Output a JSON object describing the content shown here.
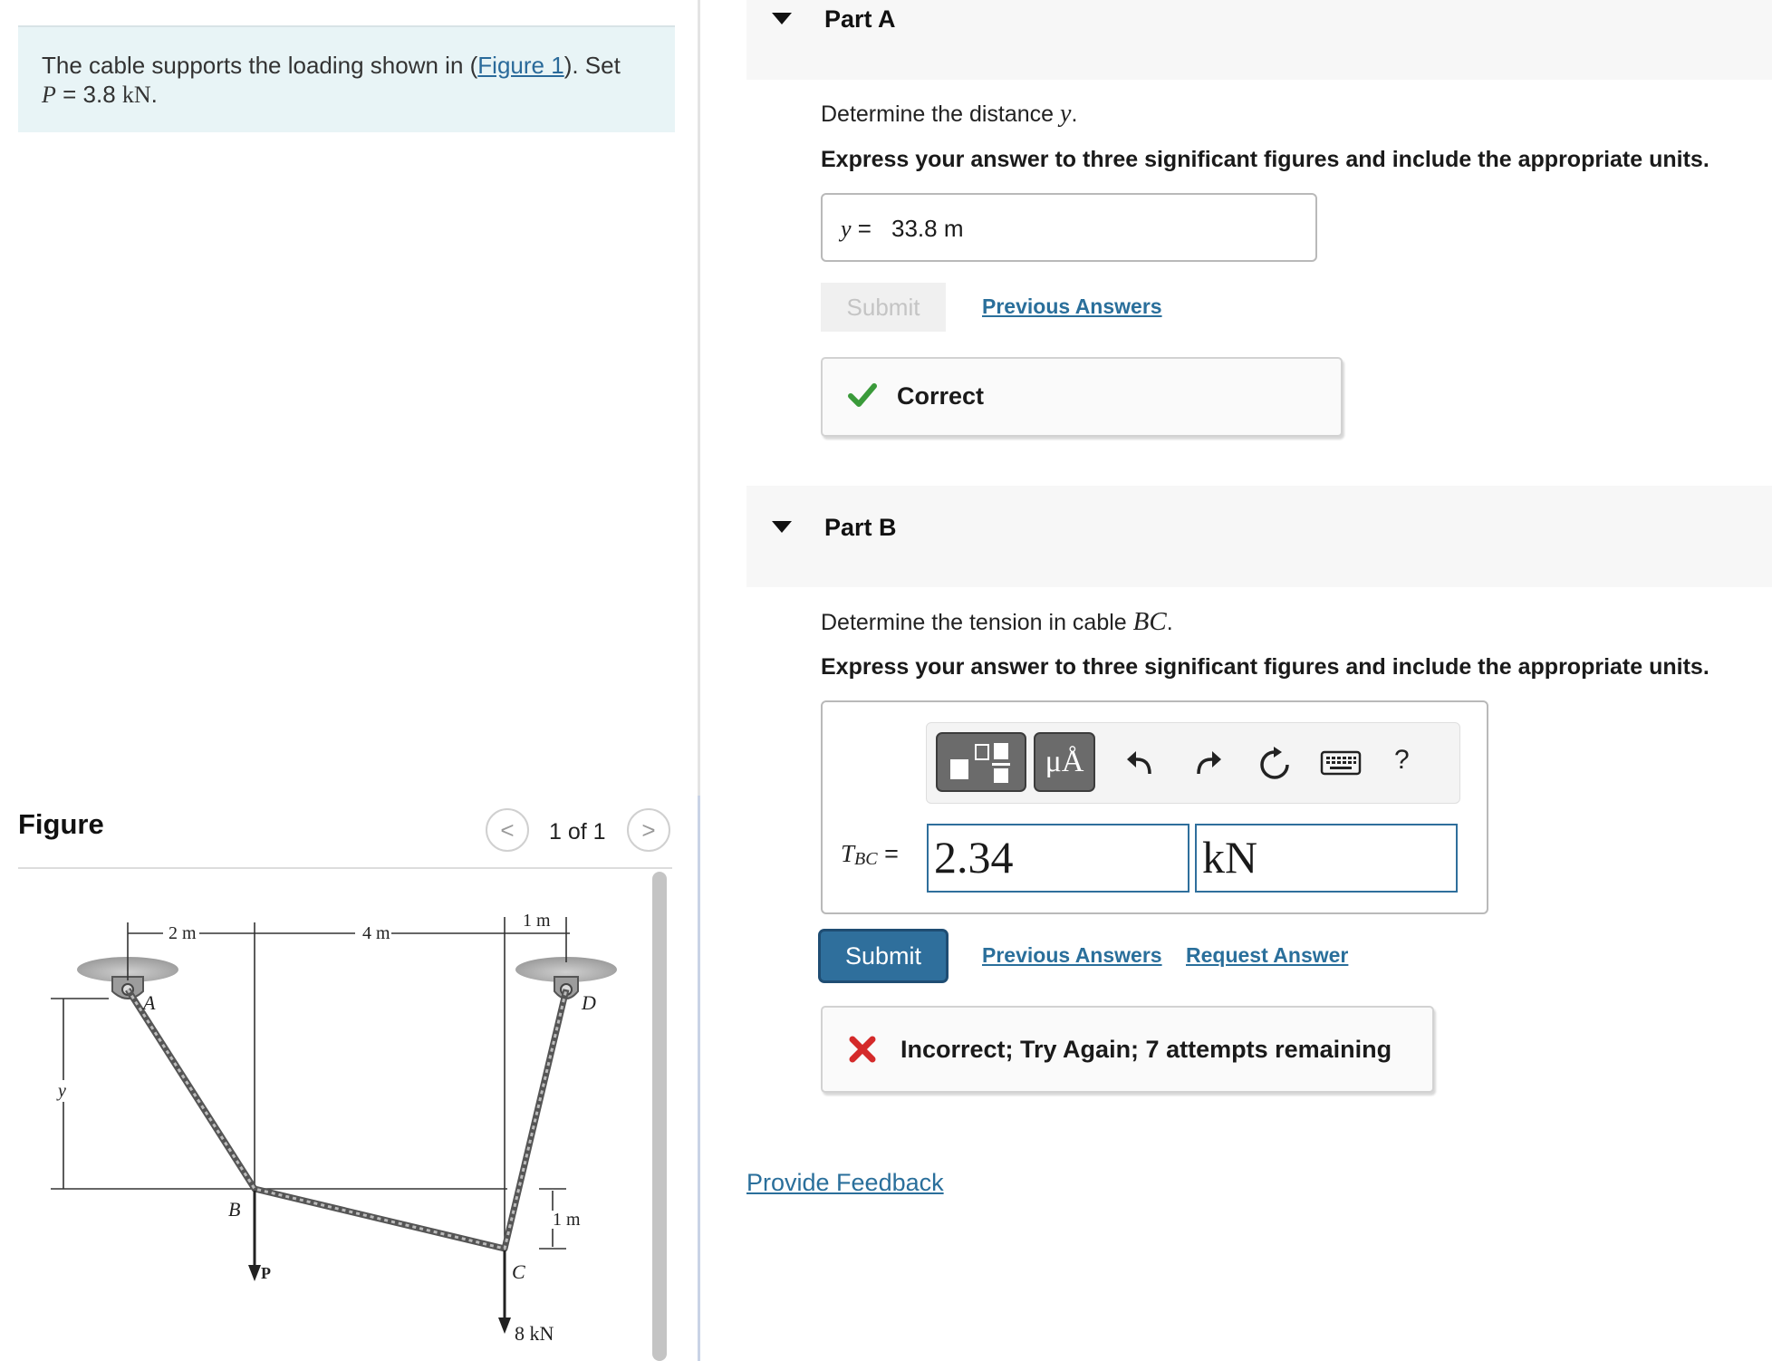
{
  "problem": {
    "text_before": "The cable supports the loading shown in (",
    "figure_link": "Figure 1",
    "text_after": "). Set",
    "var": "P",
    "eq": " = 3.8 ",
    "unit": "kN",
    "period": "."
  },
  "figure_panel": {
    "title": "Figure",
    "prev": "<",
    "next": ">",
    "count": "1 of 1",
    "labels": {
      "dim_2m": "2 m",
      "dim_4m": "4 m",
      "dim_1m_top": "1 m",
      "dim_1m_side": "1 m",
      "A": "A",
      "B": "B",
      "C": "C",
      "D": "D",
      "y": "y",
      "P": "P",
      "load": "8 kN"
    }
  },
  "partA": {
    "title": "Part A",
    "question_prefix": "Determine the distance ",
    "question_var": "y",
    "question_suffix": ".",
    "instruction": "Express your answer to three significant figures and include the appropriate units.",
    "answer_label": "y",
    "answer_eq": " =",
    "answer_value": "33.8 m",
    "submit_label": "Submit",
    "previous_answers": "Previous Answers",
    "feedback": "Correct",
    "feedback_color": "#3a9a3a"
  },
  "partB": {
    "title": "Part B",
    "question_prefix": "Determine the tension in cable ",
    "question_var": "BC",
    "question_suffix": ".",
    "instruction": "Express your answer to three significant figures and include the appropriate units.",
    "toolbar": {
      "units_button": "μÅ",
      "help": "?",
      "icons": [
        "templates-icon",
        "units-icon",
        "undo-icon",
        "redo-icon",
        "reset-icon",
        "keyboard-icon",
        "help-icon"
      ]
    },
    "answer_label_main": "T",
    "answer_label_sub": "BC",
    "answer_eq": " =",
    "value": "2.34",
    "unit": "kN",
    "submit_label": "Submit",
    "previous_answers": "Previous Answers",
    "request_answer": "Request Answer",
    "feedback": "Incorrect; Try Again; 7 attempts remaining",
    "feedback_color": "#d42a2a"
  },
  "footer": {
    "provide_feedback": "Provide Feedback"
  },
  "colors": {
    "link": "#2a6f9b",
    "primary_button": "#2f6f9c",
    "problem_bg": "#e8f4f6"
  }
}
